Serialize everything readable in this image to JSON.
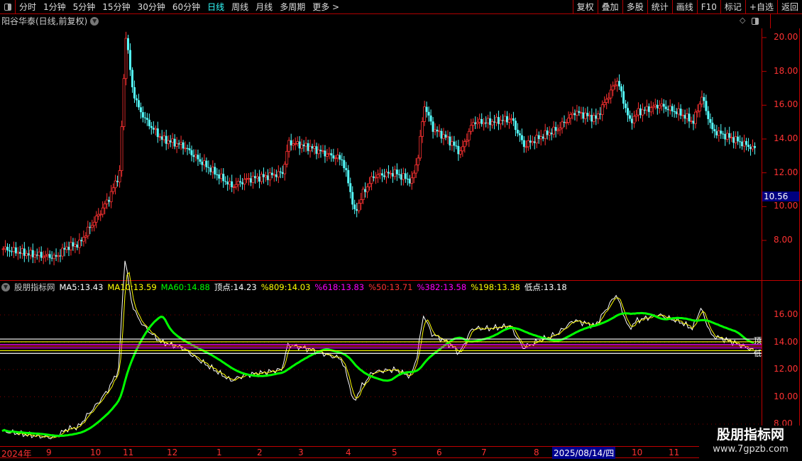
{
  "toolbar": {
    "periods": [
      "分时",
      "1分钟",
      "5分钟",
      "15分钟",
      "30分钟",
      "60分钟",
      "日线",
      "周线",
      "月线",
      "多周期",
      "更多 >"
    ],
    "active": "日线",
    "tools": [
      "复权",
      "叠加",
      "多股",
      "统计",
      "画线",
      "F10",
      "标记",
      "+自选",
      "返回"
    ]
  },
  "chart_title": "阳谷华泰(日线,前复权)",
  "price_axis": {
    "ticks": [
      "20.00",
      "18.00",
      "16.00",
      "14.00",
      "12.00",
      "10.00",
      "8.00"
    ],
    "current_price": "10.56"
  },
  "indicator": {
    "name": "股朋指标网",
    "items": [
      {
        "label": "MA5:",
        "value": "13.43",
        "color": "#ffffff"
      },
      {
        "label": "MA10:",
        "value": "13.59",
        "color": "#ffff00"
      },
      {
        "label": "MA60:",
        "value": "14.88",
        "color": "#00ff00"
      },
      {
        "label": "顶点:",
        "value": "14.23",
        "color": "#ffffff"
      },
      {
        "label": "%809:",
        "value": "14.03",
        "color": "#ffff00"
      },
      {
        "label": "%618:",
        "value": "13.83",
        "color": "#ff00ff"
      },
      {
        "label": "%50:",
        "value": "13.71",
        "color": "#ff3232"
      },
      {
        "label": "%382:",
        "value": "13.58",
        "color": "#ff00ff"
      },
      {
        "label": "%198:",
        "value": "13.38",
        "color": "#ffff00"
      },
      {
        "label": "低点:",
        "value": "13.18",
        "color": "#ffffff"
      }
    ],
    "axis_ticks": [
      "16.00",
      "14.00",
      "12.00",
      "10.00",
      "8.00"
    ],
    "end_labels": [
      "顶",
      "低"
    ]
  },
  "date_axis": {
    "labels": [
      "2024年",
      "9",
      "10",
      "11",
      "12",
      "1",
      "2",
      "3",
      "4",
      "5",
      "6",
      "7",
      "8",
      "10",
      "11"
    ],
    "cursor_date": "2025/08/14/四"
  },
  "watermark": {
    "line1": "股朋指标网",
    "line2": "www.7gpzb.com"
  },
  "chart_data": {
    "type": "candlestick",
    "ylim": [
      6,
      21
    ],
    "price_path": [
      [
        0,
        7.5
      ],
      [
        12,
        7.2
      ],
      [
        25,
        7.0
      ],
      [
        30,
        7.6
      ],
      [
        36,
        7.8
      ],
      [
        40,
        8.6
      ],
      [
        45,
        9.5
      ],
      [
        50,
        10.5
      ],
      [
        55,
        12
      ],
      [
        58,
        20.2
      ],
      [
        61,
        17
      ],
      [
        64,
        15.8
      ],
      [
        68,
        15
      ],
      [
        75,
        14
      ],
      [
        85,
        13.6
      ],
      [
        92,
        12.8
      ],
      [
        100,
        12
      ],
      [
        108,
        11.2
      ],
      [
        115,
        11.6
      ],
      [
        125,
        11.8
      ],
      [
        132,
        12
      ],
      [
        135,
        13.8
      ],
      [
        145,
        13.5
      ],
      [
        155,
        13
      ],
      [
        160,
        12.8
      ],
      [
        163,
        11.5
      ],
      [
        166,
        9.6
      ],
      [
        170,
        10.8
      ],
      [
        175,
        11.8
      ],
      [
        185,
        12
      ],
      [
        193,
        11.5
      ],
      [
        196,
        13
      ],
      [
        199,
        16
      ],
      [
        203,
        14.6
      ],
      [
        210,
        14
      ],
      [
        216,
        13.2
      ],
      [
        222,
        15
      ],
      [
        230,
        15
      ],
      [
        240,
        15.2
      ],
      [
        246,
        13.6
      ],
      [
        255,
        14.2
      ],
      [
        262,
        14.6
      ],
      [
        270,
        15.6
      ],
      [
        280,
        15.2
      ],
      [
        290,
        17.5
      ],
      [
        296,
        15
      ],
      [
        300,
        15.6
      ],
      [
        310,
        16
      ],
      [
        320,
        15.5
      ],
      [
        326,
        15
      ],
      [
        330,
        16.5
      ],
      [
        335,
        14.5
      ],
      [
        345,
        14
      ],
      [
        355,
        13.4
      ]
    ]
  }
}
